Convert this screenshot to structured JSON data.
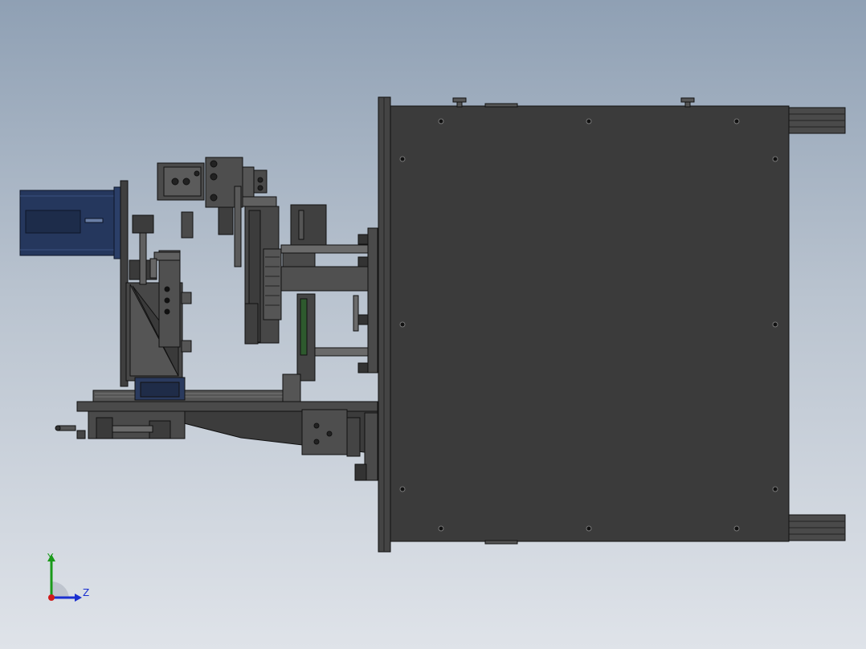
{
  "viewport": {
    "background_top": "#8fa0b4",
    "background_bottom": "#dfe3e9",
    "model_color": "#3b3b3b",
    "motor_color": "#25375d"
  },
  "triad": {
    "y_label": "Y",
    "z_label": "Z",
    "y_color": "#1a9a1a",
    "z_color": "#1a2fd0",
    "x_color": "#d01a1a"
  }
}
